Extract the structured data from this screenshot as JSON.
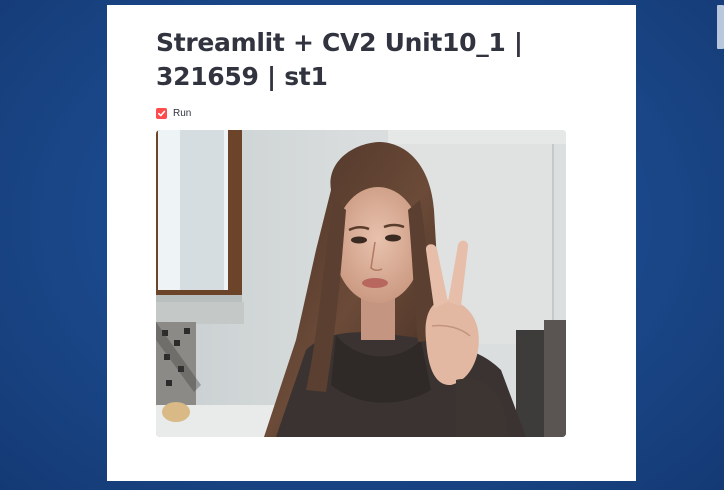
{
  "app": {
    "title": "Streamlit + CV2 Unit10_1 | 321659 | st1"
  },
  "controls": {
    "run_checkbox": {
      "label": "Run",
      "checked": true,
      "accent_color": "#ff4b4b"
    }
  },
  "video": {
    "content": "webcam frame"
  },
  "colors": {
    "desktop_background": "#1c4a8e",
    "app_background": "#ffffff",
    "text": "#31333f"
  }
}
